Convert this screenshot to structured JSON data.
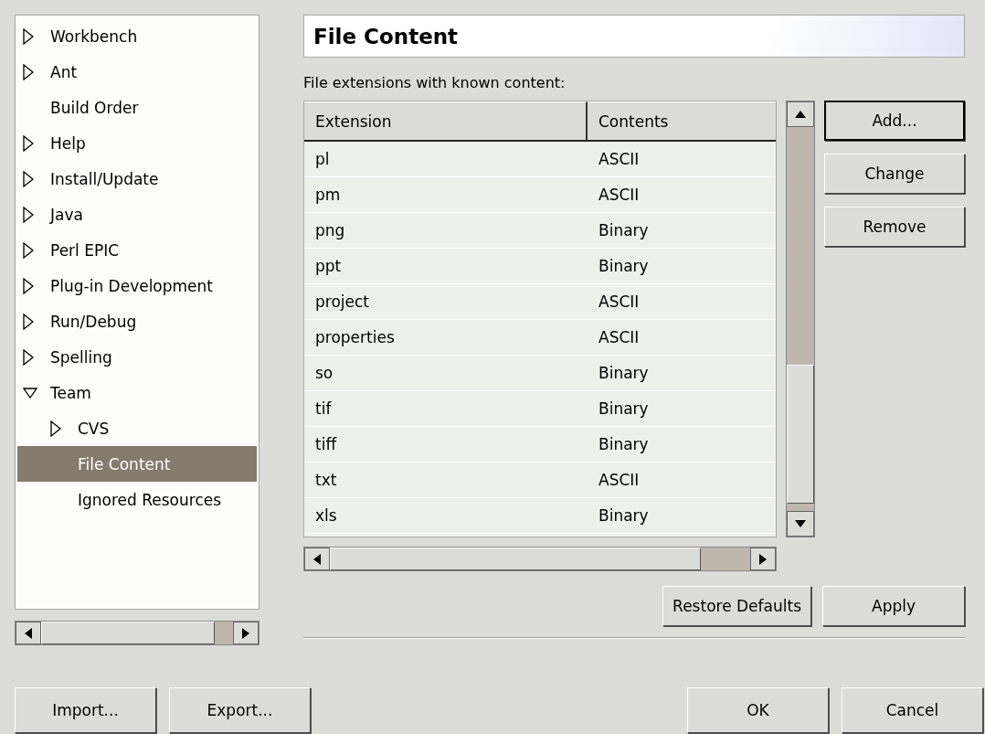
{
  "tree": [
    {
      "label": "Workbench",
      "expanded": false,
      "selected": false
    },
    {
      "label": "Ant",
      "expanded": false,
      "selected": false
    },
    {
      "label": "Build Order",
      "selected": false
    },
    {
      "label": "Help",
      "expanded": false,
      "selected": false
    },
    {
      "label": "Install/Update",
      "expanded": false,
      "selected": false
    },
    {
      "label": "Java",
      "expanded": false,
      "selected": false
    },
    {
      "label": "Perl EPIC",
      "expanded": false,
      "selected": false
    },
    {
      "label": "Plug-in Development",
      "expanded": false,
      "selected": false
    },
    {
      "label": "Run/Debug",
      "expanded": false,
      "selected": false
    },
    {
      "label": "Spelling",
      "expanded": false,
      "selected": false
    },
    {
      "label": "Team",
      "expanded": true,
      "selected": false,
      "children": [
        {
          "label": "CVS",
          "expanded": false,
          "selected": false
        },
        {
          "label": "File Content",
          "selected": true
        },
        {
          "label": "Ignored Resources",
          "selected": false
        }
      ]
    }
  ],
  "page_title": "File Content",
  "table_label": "File extensions with known content:",
  "table": {
    "columns": [
      "Extension",
      "Contents"
    ],
    "rows": [
      [
        "pl",
        "ASCII"
      ],
      [
        "pm",
        "ASCII"
      ],
      [
        "png",
        "Binary"
      ],
      [
        "ppt",
        "Binary"
      ],
      [
        "project",
        "ASCII"
      ],
      [
        "properties",
        "ASCII"
      ],
      [
        "so",
        "Binary"
      ],
      [
        "tif",
        "Binary"
      ],
      [
        "tiff",
        "Binary"
      ],
      [
        "txt",
        "ASCII"
      ],
      [
        "xls",
        "Binary"
      ]
    ]
  },
  "side_buttons": [
    {
      "label": "Add...",
      "default": true
    },
    {
      "label": "Change",
      "default": false
    },
    {
      "label": "Remove",
      "default": false
    }
  ],
  "page_buttons": [
    "Restore Defaults",
    "Apply"
  ],
  "left_buttons": [
    "Import...",
    "Export..."
  ],
  "dialog_buttons": [
    "OK",
    "Cancel"
  ]
}
